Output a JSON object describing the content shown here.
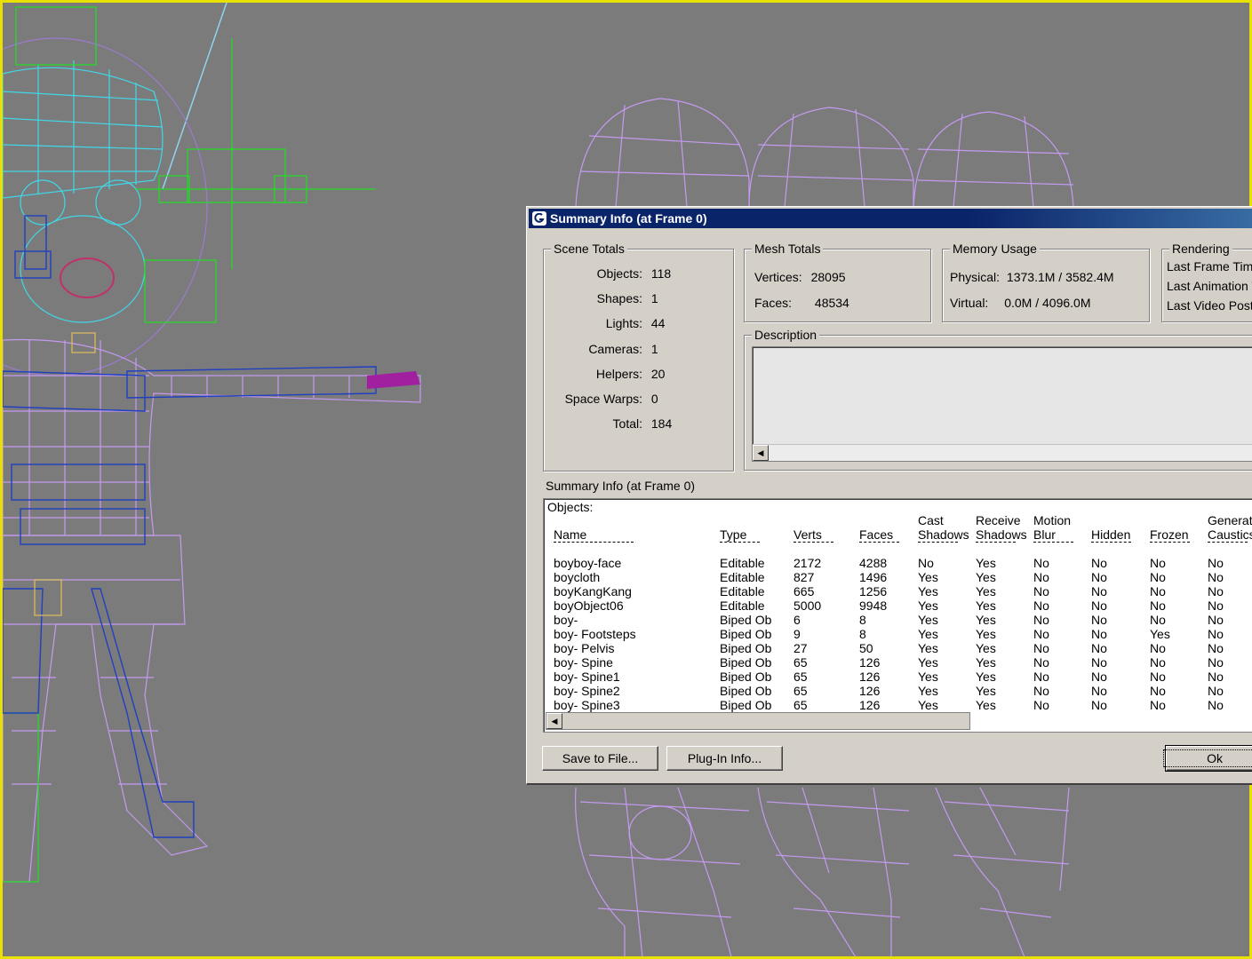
{
  "dialog": {
    "title": "Summary Info (at Frame 0)",
    "scene_totals": {
      "legend": "Scene Totals",
      "items": [
        {
          "label": "Objects:",
          "value": "118"
        },
        {
          "label": "Shapes:",
          "value": "1"
        },
        {
          "label": "Lights:",
          "value": "44"
        },
        {
          "label": "Cameras:",
          "value": "1"
        },
        {
          "label": "Helpers:",
          "value": "20"
        },
        {
          "label": "Space Warps:",
          "value": "0"
        },
        {
          "label": "Total:",
          "value": "184"
        }
      ]
    },
    "mesh_totals": {
      "legend": "Mesh Totals",
      "vertices_label": "Vertices:",
      "vertices": "28095",
      "faces_label": "Faces:",
      "faces": "48534"
    },
    "memory_usage": {
      "legend": "Memory Usage",
      "physical_label": "Physical:",
      "physical": "1373.1M / 3582.4M",
      "virtual_label": "Virtual:",
      "virtual": "0.0M / 4096.0M"
    },
    "rendering": {
      "legend": "Rendering",
      "last_frame_time": "Last Frame Time",
      "last_animation": "Last Animation T",
      "last_video_post": "Last Video Post"
    },
    "description": {
      "legend": "Description"
    },
    "list_caption": "Summary Info (at Frame 0)",
    "objects_label": "Objects:",
    "columns": {
      "name": "Name",
      "type": "Type",
      "verts": "Verts",
      "faces": "Faces",
      "cast_1": "Cast",
      "cast_2": "Shadows",
      "receive_1": "Receive",
      "receive_2": "Shadows",
      "motion_1": "Motion",
      "motion_2": "Blur",
      "hidden": "Hidden",
      "frozen": "Frozen",
      "gen_1": "Generate",
      "gen_2": "Caustics"
    },
    "rows": [
      [
        "boyboy-face",
        "Editable",
        "2172",
        "4288",
        "No",
        "Yes",
        "No",
        "No",
        "No",
        "No"
      ],
      [
        "boycloth",
        "Editable",
        "827",
        "1496",
        "Yes",
        "Yes",
        "No",
        "No",
        "No",
        "No"
      ],
      [
        "boyKangKang",
        "Editable",
        "665",
        "1256",
        "Yes",
        "Yes",
        "No",
        "No",
        "No",
        "No"
      ],
      [
        "boyObject06",
        "Editable",
        "5000",
        "9948",
        "Yes",
        "Yes",
        "No",
        "No",
        "No",
        "No"
      ],
      [
        "boy-",
        "Biped Ob",
        "6",
        "8",
        "Yes",
        "Yes",
        "No",
        "No",
        "No",
        "No"
      ],
      [
        "boy- Footsteps",
        "Biped Ob",
        "9",
        "8",
        "Yes",
        "Yes",
        "No",
        "No",
        "Yes",
        "No"
      ],
      [
        "boy- Pelvis",
        "Biped Ob",
        "27",
        "50",
        "Yes",
        "Yes",
        "No",
        "No",
        "No",
        "No"
      ],
      [
        "boy- Spine",
        "Biped Ob",
        "65",
        "126",
        "Yes",
        "Yes",
        "No",
        "No",
        "No",
        "No"
      ],
      [
        "boy- Spine1",
        "Biped Ob",
        "65",
        "126",
        "Yes",
        "Yes",
        "No",
        "No",
        "No",
        "No"
      ],
      [
        "boy- Spine2",
        "Biped Ob",
        "65",
        "126",
        "Yes",
        "Yes",
        "No",
        "No",
        "No",
        "No"
      ],
      [
        "boy- Spine3",
        "Biped Ob",
        "65",
        "126",
        "Yes",
        "Yes",
        "No",
        "No",
        "No",
        "No"
      ]
    ],
    "buttons": {
      "save": "Save to File...",
      "plugin": "Plug-In Info...",
      "ok": "Ok"
    }
  },
  "colors": {
    "viewport_bg": "#7b7b7b",
    "viewport_border": "#e8e000",
    "wire_purple": "#c49af0",
    "wire_cyan": "#40d8e8",
    "wire_green": "#20e020",
    "wire_blue": "#2040c0",
    "title_bar": "#0a246a"
  }
}
